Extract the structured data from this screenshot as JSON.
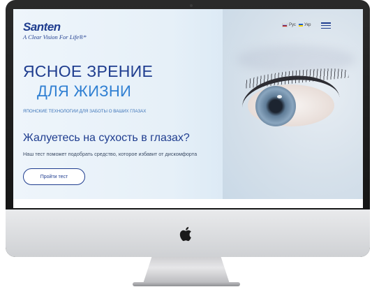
{
  "brand": {
    "logo_text": "Santen",
    "tagline": "A Clear Vision For Life®*"
  },
  "header": {
    "languages": [
      {
        "label": "Рус",
        "flag": "ru-flag-icon"
      },
      {
        "label": "Укр",
        "flag": "ua-flag-icon"
      }
    ],
    "menu_icon": "hamburger-icon"
  },
  "hero": {
    "title_line1": "ЯСНОЕ ЗРЕНИЕ",
    "title_line2": "ДЛЯ ЖИЗНИ",
    "subtitle": "ЯПОНСКИЕ ТЕХНОЛОГИИ ДЛЯ ЗАБОТЫ О ВАШИХ ГЛАЗАХ",
    "question": "Жалуетесь на сухость в глазах?",
    "description": "Наш тест поможет подобрать средство, которое избавит от дискомфорта",
    "cta_label": "Пройти тест"
  },
  "colors": {
    "primary": "#1f3d8f",
    "accent": "#2f7fd2",
    "background": "#e6f0f8"
  },
  "device": {
    "logo_icon": "apple-icon"
  }
}
